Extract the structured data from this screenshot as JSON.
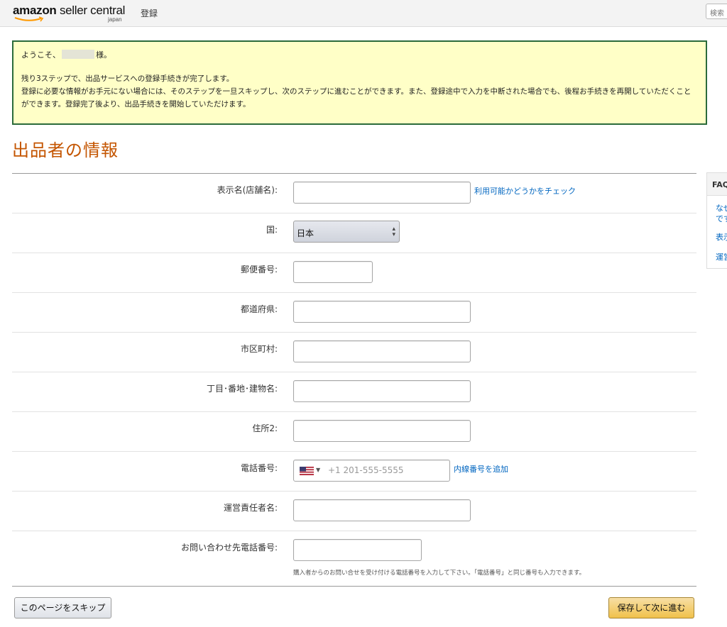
{
  "header": {
    "logo_brand": "amazon",
    "logo_product": "seller central",
    "logo_region": "japan",
    "nav_register": "登録",
    "search_placeholder": "検索"
  },
  "welcome": {
    "greeting_prefix": "ようこそ、",
    "greeting_suffix": "様。",
    "line_steps": "残り3ステップで、出品サービスへの登録手続きが完了します。",
    "line_info": "登録に必要な情報がお手元にない場合には、そのステップを一旦スキップし、次のステップに進むことができます。また、登録途中で入力を中断された場合でも、後程お手続きを再開していただくことができます。登録完了後より、出品手続きを開始していただけます。"
  },
  "page_title": "出品者の情報",
  "form": {
    "display_name_label": "表示名(店舗名):",
    "check_availability_link": "利用可能かどうかをチェック",
    "country_label": "国:",
    "country_value": "日本",
    "postal_label": "郵便番号:",
    "prefecture_label": "都道府県:",
    "city_label": "市区町村:",
    "street_label": "丁目･番地･建物名:",
    "address2_label": "住所2:",
    "phone_label": "電話番号:",
    "phone_placeholder": "+1 201-555-5555",
    "add_extension_link": "内線番号を追加",
    "manager_label": "運営責任者名:",
    "contact_phone_label": "お問い合わせ先電話番号:",
    "contact_phone_hint": "購入者からのお問い合せを受け付ける電話番号を入力して下さい。「電話番号」と同じ番号も入力できます。"
  },
  "buttons": {
    "skip": "このページをスキップ",
    "save_next": "保存して次に進む"
  },
  "faq": {
    "title": "FAQ",
    "items": [
      "なぜ",
      "です",
      "表示",
      "運営"
    ]
  },
  "colors": {
    "title_orange": "#c45500",
    "link_blue": "#0066c0",
    "welcome_bg": "#ffffc7",
    "welcome_border": "#2b6b3a"
  }
}
